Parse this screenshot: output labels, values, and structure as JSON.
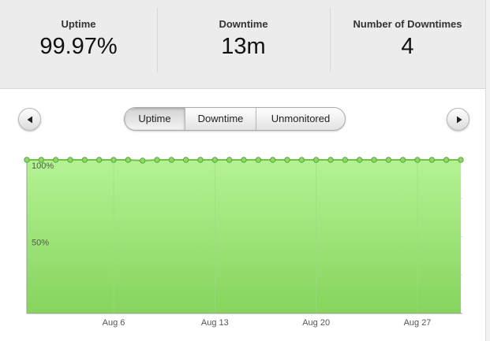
{
  "stats": [
    {
      "label": "Uptime",
      "value": "99.97%"
    },
    {
      "label": "Downtime",
      "value": "13m"
    },
    {
      "label": "Number of Downtimes",
      "value": "4"
    }
  ],
  "tabs": [
    {
      "label": "Uptime",
      "active": true
    },
    {
      "label": "Downtime",
      "active": false
    },
    {
      "label": "Unmonitored",
      "active": false
    }
  ],
  "nav": {
    "prev_icon": "triangle-left-icon",
    "next_icon": "triangle-right-icon"
  },
  "colors": {
    "fill_top": "#b4f394",
    "fill_bottom": "#86d45d",
    "line": "#6fc24a",
    "marker": "#8ed86a",
    "marker_stroke": "#5aa83a"
  },
  "chart_data": {
    "type": "area",
    "x_start": "Jul 31",
    "x_end": "Aug 31",
    "x_ticks": [
      "Aug 6",
      "Aug 13",
      "Aug 20",
      "Aug 27"
    ],
    "y_ticks": [
      "100%",
      "50%"
    ],
    "ylim": [
      0,
      100
    ],
    "grid": true,
    "values": [
      100,
      100,
      100,
      100,
      100,
      100,
      100,
      100,
      99.5,
      100,
      100,
      100,
      100,
      100,
      100,
      100,
      100,
      100,
      100,
      100,
      100,
      100,
      100,
      100,
      100,
      100,
      100,
      100,
      100,
      100,
      100
    ]
  }
}
